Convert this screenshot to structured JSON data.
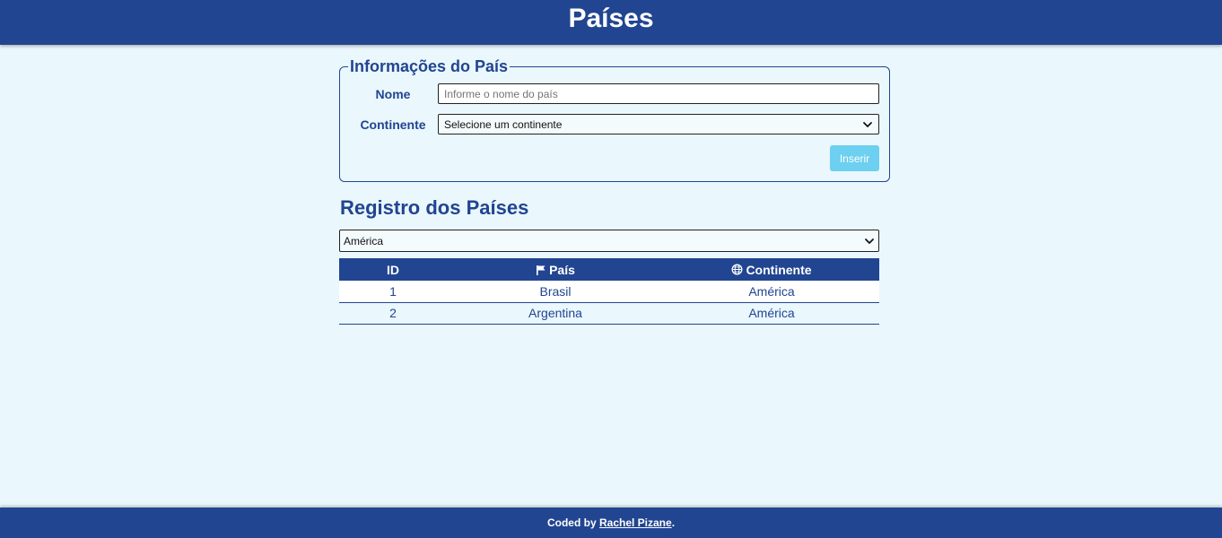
{
  "header": {
    "title": "Países"
  },
  "form": {
    "legend": "Informações do País",
    "name_label": "Nome",
    "name_placeholder": "Informe o nome do país",
    "name_value": "",
    "continent_label": "Continente",
    "continent_selected": "Selecione um continente",
    "submit_label": "Inserir"
  },
  "registry": {
    "title": "Registro dos Países",
    "filter_selected": "América",
    "columns": {
      "id": "ID",
      "country": "País",
      "continent": "Continente"
    },
    "rows": [
      {
        "id": "1",
        "country": "Brasil",
        "continent": "América"
      },
      {
        "id": "2",
        "country": "Argentina",
        "continent": "América"
      }
    ]
  },
  "footer": {
    "prefix": "Coded by",
    "author": "Rachel Pizane",
    "suffix": "."
  },
  "colors": {
    "primary": "#214591",
    "background": "#eaf7fd",
    "button": "#6dd0f0"
  },
  "icons": {
    "country_header": "flag-icon",
    "continent_header": "globe-icon",
    "select_arrow": "chevron-down-icon"
  }
}
